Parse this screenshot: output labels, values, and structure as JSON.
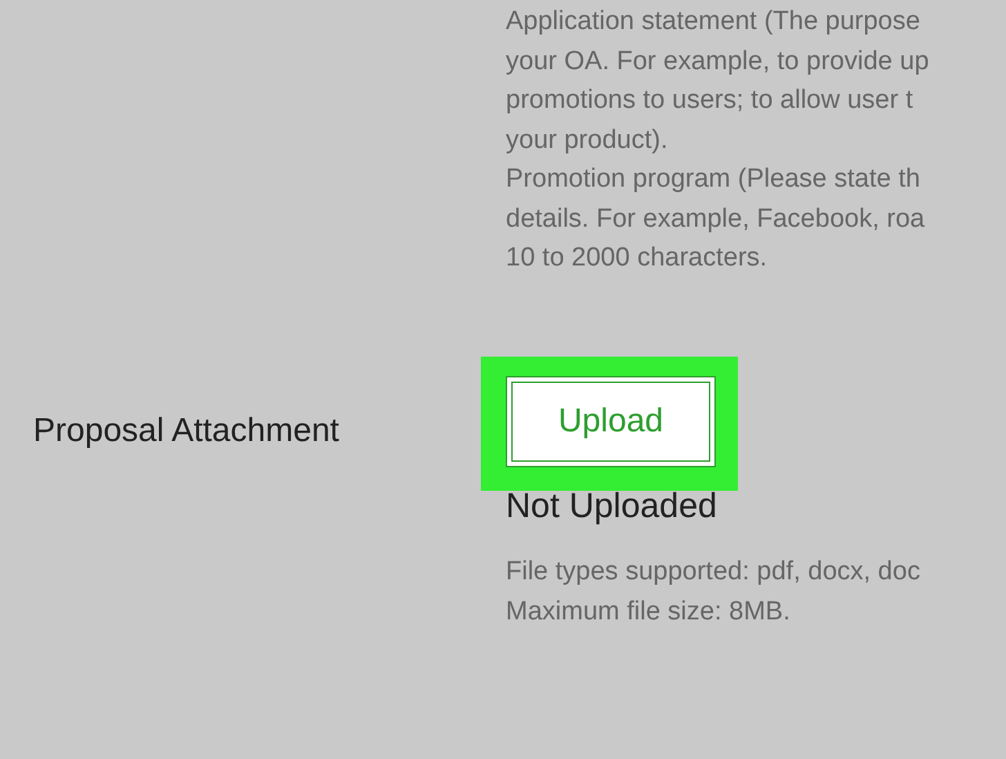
{
  "description_lines": [
    "Application statement (The purpose",
    "your OA. For example, to provide up",
    "promotions to users; to allow user t",
    "your product).",
    "Promotion program (Please state th",
    "details. For example, Facebook, roa",
    "10 to 2000 characters."
  ],
  "attachment": {
    "label": "Proposal Attachment",
    "button": "Upload",
    "highlighted": true,
    "status": "Not Uploaded",
    "notes": [
      "File types supported: pdf, docx, doc",
      "Maximum file size: 8MB."
    ]
  }
}
